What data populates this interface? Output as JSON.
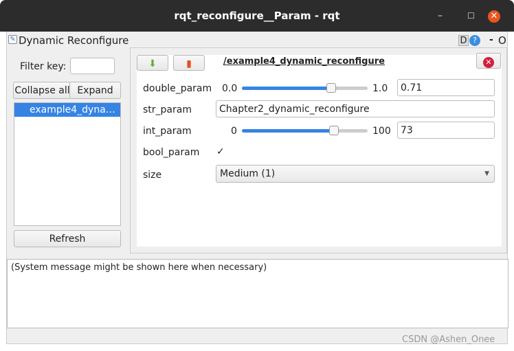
{
  "window": {
    "title": "rqt_reconfigure__Param - rqt",
    "minimize": "–",
    "maximize": "☐",
    "close": "✕"
  },
  "plugin": {
    "title": "Dynamic Reconfigure",
    "d_label": "D",
    "help": "?",
    "dash": "-",
    "o": "O"
  },
  "left": {
    "filter_label": "Filter key:",
    "filter_value": "",
    "collapse": "Collapse all",
    "expand": "Expand all",
    "tree_items": [
      "example4_dyna…"
    ],
    "refresh": "Refresh"
  },
  "panel": {
    "node": "/example4_dynamic_reconfigure",
    "params": {
      "double": {
        "label": "double_param",
        "min": "0.0",
        "max": "1.0",
        "value": "0.71",
        "fraction": 0.71
      },
      "str": {
        "label": "str_param",
        "value": "Chapter2_dynamic_reconfigure"
      },
      "int": {
        "label": "int_param",
        "min": "0",
        "max": "100",
        "value": "73",
        "fraction": 0.73
      },
      "bool": {
        "label": "bool_param",
        "checked": true,
        "mark": "✓"
      },
      "size": {
        "label": "size",
        "value": "Medium (1)"
      }
    }
  },
  "status": {
    "message": "(System message might be shown here when necessary)"
  },
  "watermark": "CSDN @Ashen_Onee",
  "colors": {
    "accent": "#3584e4",
    "titlebar": "#2c2c2c",
    "close": "#e95420"
  }
}
